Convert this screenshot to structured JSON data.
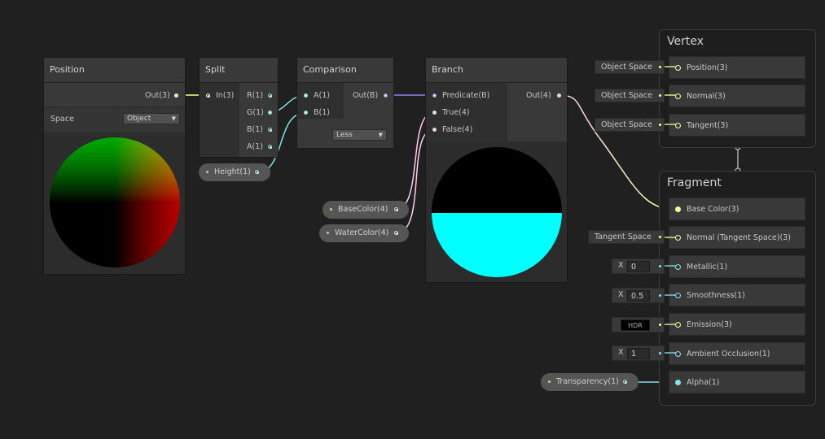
{
  "colors": {
    "background": "#202020",
    "node": "#393939",
    "vec1": "#84e4e7",
    "vec3": "#f6ff9a",
    "vec4": "#fbcbf4",
    "bool": "#9481e6",
    "branch_true": "#000000",
    "branch_false": "#00ffff"
  },
  "position_node": {
    "title": "Position",
    "out_label": "Out(3)",
    "space_label": "Space",
    "space_value": "Object"
  },
  "split_node": {
    "title": "Split",
    "in_label": "In(3)",
    "outputs": [
      "R(1)",
      "G(1)",
      "B(1)",
      "A(1)"
    ]
  },
  "comparison_node": {
    "title": "Comparison",
    "inputs": [
      "A(1)",
      "B(1)"
    ],
    "out_label": "Out(B)",
    "operator": "Less"
  },
  "branch_node": {
    "title": "Branch",
    "inputs": [
      "Predicate(B)",
      "True(4)",
      "False(4)"
    ],
    "out_label": "Out(4)"
  },
  "properties": {
    "height": "Height(1)",
    "base_color": "BaseColor(4)",
    "water_color": "WaterColor(4)",
    "transparency": "Transparency(1)"
  },
  "vertex": {
    "title": "Vertex",
    "blocks": [
      {
        "label": "Position(3)",
        "chip": "Object Space"
      },
      {
        "label": "Normal(3)",
        "chip": "Object Space"
      },
      {
        "label": "Tangent(3)",
        "chip": "Object Space"
      }
    ]
  },
  "fragment": {
    "title": "Fragment",
    "base_color": "Base Color(3)",
    "normal": "Normal (Tangent Space)(3)",
    "normal_chip": "Tangent Space",
    "metallic": "Metallic(1)",
    "metallic_x": "X",
    "metallic_value": "0",
    "smoothness": "Smoothness(1)",
    "smoothness_x": "X",
    "smoothness_value": "0.5",
    "emission": "Emission(3)",
    "emission_hdr": "HDR",
    "ambient_occlusion": "Ambient Occlusion(1)",
    "ao_x": "X",
    "ao_value": "1",
    "alpha": "Alpha(1)"
  }
}
